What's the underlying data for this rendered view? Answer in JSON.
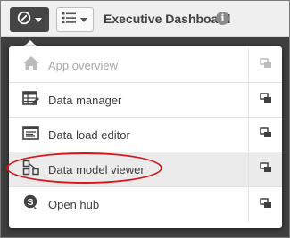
{
  "header": {
    "title": "Executive Dashboard",
    "info_glyph": "i"
  },
  "menu": {
    "items": [
      {
        "label": "App overview",
        "icon": "home-icon",
        "state": "disabled"
      },
      {
        "label": "Data manager",
        "icon": "data-manager-icon",
        "state": "normal"
      },
      {
        "label": "Data load editor",
        "icon": "data-load-editor-icon",
        "state": "normal"
      },
      {
        "label": "Data model viewer",
        "icon": "data-model-viewer-icon",
        "state": "highlighted"
      },
      {
        "label": "Open hub",
        "icon": "hub-icon",
        "state": "normal"
      }
    ],
    "side_icon": "open-in-new-tab-icon"
  },
  "colors": {
    "backdrop": "#3f3f3f",
    "annotation": "#d4171d",
    "hub_icon": "#404040"
  }
}
